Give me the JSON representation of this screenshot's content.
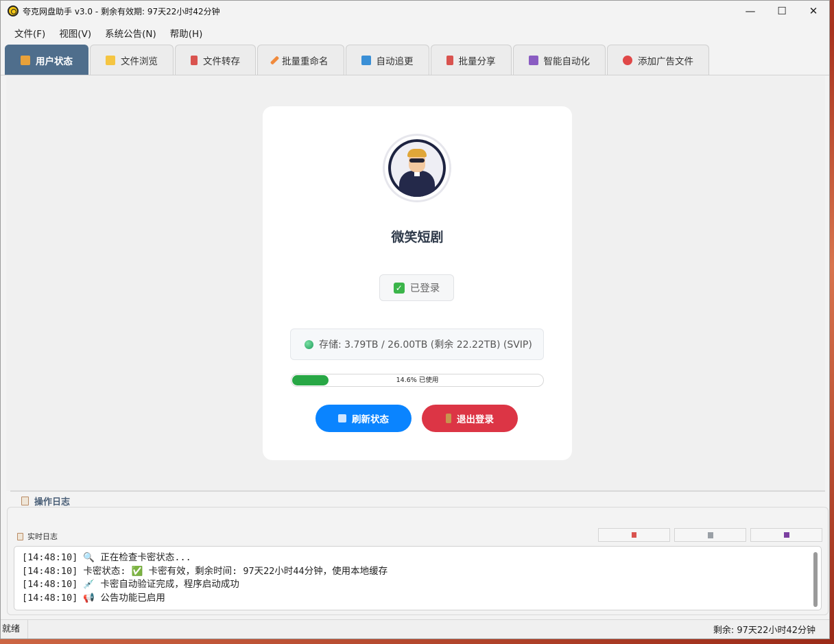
{
  "window": {
    "title": "夸克网盘助手 v3.0 - 剩余有效期: 97天22小时42分钟",
    "controls": {
      "minimize": "—",
      "maximize": "☐",
      "close": "✕"
    }
  },
  "menu": [
    {
      "label": "文件(F)"
    },
    {
      "label": "视图(V)"
    },
    {
      "label": "系统公告(N)"
    },
    {
      "label": "帮助(H)"
    }
  ],
  "tabs": [
    {
      "label": "用户状态",
      "icon": "lock-icon",
      "color": "#e8a13a",
      "active": true
    },
    {
      "label": "文件浏览",
      "icon": "folder-icon",
      "color": "#f5c542"
    },
    {
      "label": "文件转存",
      "icon": "upload-icon",
      "color": "#d9534f"
    },
    {
      "label": "批量重命名",
      "icon": "pencil-icon",
      "color": "#f08a3c"
    },
    {
      "label": "自动追更",
      "icon": "refresh-icon",
      "color": "#3a8fd6"
    },
    {
      "label": "批量分享",
      "icon": "share-icon",
      "color": "#d9534f"
    },
    {
      "label": "智能自动化",
      "icon": "robot-icon",
      "color": "#8a5cc2"
    },
    {
      "label": "添加广告文件",
      "icon": "target-icon",
      "color": "#e04848"
    }
  ],
  "user": {
    "name": "微笑短剧",
    "login_status": "已登录",
    "storage": "存储: 3.79TB / 26.00TB (剩余 22.22TB) (SVIP)",
    "usage_fraction": 0.146,
    "usage_text": "14.6% 已使用"
  },
  "buttons": {
    "refresh": "刷新状态",
    "logout": "退出登录"
  },
  "log": {
    "title": "操作日志",
    "subtitle": "实时日志",
    "tools": [
      "upload-icon",
      "trash-icon",
      "save-icon"
    ],
    "lines": [
      "[14:48:10] 🔍 正在检查卡密状态...",
      "[14:48:10] 卡密状态: ✅ 卡密有效，剩余时间: 97天22小时44分钟，使用本地缓存",
      "[14:48:10] 💉 卡密自动验证完成，程序启动成功",
      "[14:48:10] 📢 公告功能已启用"
    ]
  },
  "statusbar": {
    "left": "就绪",
    "right": "剩余: 97天22小时42分钟"
  },
  "colors": {
    "tab_active": "#4f6e8c",
    "refresh_button": "#0a84ff",
    "logout_button": "#dc3545",
    "progress": "#28a745"
  }
}
